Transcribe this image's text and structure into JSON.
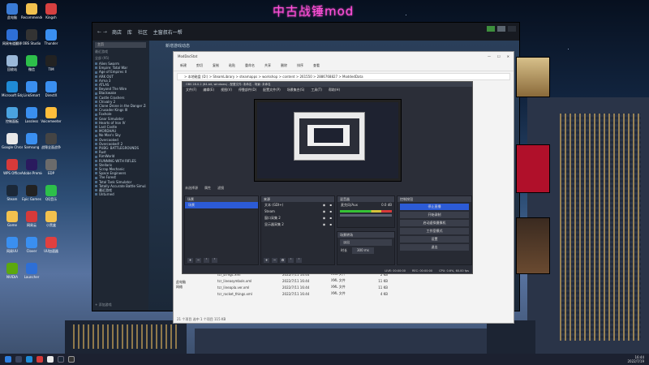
{
  "overlay": {
    "title": "中古战锤mod"
  },
  "desktop_icons": [
    {
      "label": "此电脑",
      "icon": "computer-icon",
      "color": "#3a7bd5"
    },
    {
      "label": "Recommended",
      "icon": "folder-icon",
      "color": "#f2c14e"
    },
    {
      "label": "Kingsh",
      "icon": "app-icon",
      "color": "#d64040"
    },
    {
      "label": "网易有道翻译",
      "icon": "translate-icon",
      "color": "#2e6fd6"
    },
    {
      "label": "OBS Studio",
      "icon": "obs-icon",
      "color": "#333333"
    },
    {
      "label": "Thunder",
      "icon": "thunder-icon",
      "color": "#3a8ff0"
    },
    {
      "label": "回收站",
      "icon": "recycle-bin-icon",
      "color": "#9ab8d8"
    },
    {
      "label": "微信",
      "icon": "wechat-icon",
      "color": "#2dbf4a"
    },
    {
      "label": "TIM",
      "icon": "app-icon",
      "color": "#222222"
    },
    {
      "label": "Microsoft Edge",
      "icon": "edge-icon",
      "color": "#1f8bd6"
    },
    {
      "label": "LinkSmart",
      "icon": "app-icon",
      "color": "#3a8ff0"
    },
    {
      "label": "DirectX",
      "icon": "app-icon",
      "color": "#3a8ff0"
    },
    {
      "label": "控制面板",
      "icon": "control-panel-icon",
      "color": "#4aa3e0"
    },
    {
      "label": "Lossless",
      "icon": "app-icon",
      "color": "#3a8ff0"
    },
    {
      "label": "Voicemeeter",
      "icon": "app-icon",
      "color": "#ffbe3b"
    },
    {
      "label": "Google Chrome",
      "icon": "chrome-icon",
      "color": "#e8e8e8"
    },
    {
      "label": "Samsung",
      "icon": "app-icon",
      "color": "#3a8ff0"
    },
    {
      "label": "战锤全面战争",
      "icon": "game-icon",
      "color": "#444444"
    },
    {
      "label": "WPS Office",
      "icon": "wps-icon",
      "color": "#d63a3a"
    },
    {
      "label": "Adobe Premiere",
      "icon": "premiere-icon",
      "color": "#2a1a5e"
    },
    {
      "label": "EDP",
      "icon": "app-icon",
      "color": "#6b6b6b"
    },
    {
      "label": "Steam",
      "icon": "steam-icon",
      "color": "#1b2838"
    },
    {
      "label": "Epic Games",
      "icon": "epic-icon",
      "color": "#222222"
    },
    {
      "label": "QQ音乐",
      "icon": "music-icon",
      "color": "#2dbf4a"
    },
    {
      "label": "Game",
      "icon": "folder-icon",
      "color": "#f2c14e"
    },
    {
      "label": "网易云",
      "icon": "app-icon",
      "color": "#d63a3a"
    },
    {
      "label": "小黑盒",
      "icon": "folder-icon",
      "color": "#f2c14e"
    },
    {
      "label": "网易UU",
      "icon": "app-icon",
      "color": "#3a8ff0"
    },
    {
      "label": "Clover",
      "icon": "app-icon",
      "color": "#3a8ff0"
    },
    {
      "label": "UU加速器",
      "icon": "uu-icon",
      "color": "#e04040"
    },
    {
      "label": "NVIDIA",
      "icon": "nvidia-icon",
      "color": "#5ca80f"
    },
    {
      "label": "Launcher",
      "icon": "app-icon",
      "color": "#2e6fd6"
    }
  ],
  "steam": {
    "nav": "← →",
    "tabs": [
      "商店",
      "库",
      "社区",
      "主窗叔右一帮"
    ],
    "home": "主页",
    "filter": "最近游戏",
    "group": "全部 (95)",
    "games": [
      "Alien Swarm",
      "Empire: Total War",
      "Age of Empires II",
      "ARK OUT",
      "Arma 3",
      "ATLAS",
      "Beyond The Wire",
      "Blackwake",
      "Castle Crashers",
      "Chivalry 2",
      "Clone Drone in the Danger Zone",
      "Crusader Kings III",
      "Foxhole",
      "Gear Simulator",
      "Hearts of Iron IV",
      "Last Castle",
      "MORDHAU",
      "No Man's Sky",
      "Overcooked",
      "Overcooked! 2",
      "PUBG: BATTLEGROUNDS",
      "Rust",
      "RimWorld",
      "RUNNING WITH RIFLES",
      "Stellaris",
      "Scrap Mechanic",
      "Space Engineers",
      "The Forest",
      "Total Tank Simulator",
      "Totally Accurate Battle Simulator",
      "最近游戏",
      "Unturned"
    ],
    "add": "+ 添加游戏",
    "news": "新增游戏动态"
  },
  "explorer": {
    "title": "ModDocStat",
    "toolbar": [
      "新建",
      "剪切",
      "复制",
      "粘贴",
      "重命名",
      "共享",
      "删除",
      "排序",
      "查看"
    ],
    "address": "> 本地磁盘 (D:) > SteamLibrary > steamapps > workshop > content > 261550 > 2886768827 > ModdedData",
    "side": [
      "此电脑",
      "网络"
    ],
    "files": [
      {
        "name": "tcr_b.mgc.xml",
        "date": "2022/7/11 16:44",
        "type": "XML 文件",
        "size": "2 KB"
      },
      {
        "name": "tcr_lineasymbols.xml",
        "date": "2022/7/11 16:44",
        "type": "XML 文件",
        "size": "11 KB"
      },
      {
        "name": "tcr_lineapla.ver.xml",
        "date": "2022/7/11 16:44",
        "type": "XML 文件",
        "size": "11 KB"
      },
      {
        "name": "tcr_rocket_things.xml",
        "date": "2022/7/11 16:44",
        "type": "XML 文件",
        "size": "4 KB"
      }
    ],
    "status": "21 个项目  选中 1 个项目  115 KB"
  },
  "obs": {
    "title": "OBS 28.0.2 (64-bit, windows) - 配置文件: 未命名 - 场景: 未命名",
    "menu": [
      "文件(F)",
      "编辑(E)",
      "视图(V)",
      "停靠部件(D)",
      "配置文件(P)",
      "场景集合(S)",
      "工具(T)",
      "帮助(H)"
    ],
    "source_bar": [
      "未选择源",
      "属性",
      "滤镜"
    ],
    "scenes": {
      "header": "场景",
      "items": [
        "场景"
      ]
    },
    "sources": {
      "header": "来源",
      "items": [
        "文本 (GDI+)",
        "Steam",
        "窗口采集 2",
        "显示器采集 2"
      ]
    },
    "mixer": {
      "header": "混音器",
      "channel": "麦克风/Aux",
      "db": "0.0 dB"
    },
    "transitions": {
      "header": "场景转场",
      "type": "淡出",
      "duration_label": "时长",
      "duration": "300 ms"
    },
    "controls": {
      "header": "控制按钮",
      "buttons": [
        "停止直播",
        "开始录制",
        "启动虚拟摄像机",
        "工作室模式",
        "设置",
        "退出"
      ]
    },
    "status": [
      "LIVE: 00:00:00",
      "REC: 00:00:00",
      "CPU: 0.6%, 60.00 fps"
    ]
  },
  "taskbar": {
    "time": "16:44",
    "date": "2022/7/19"
  }
}
